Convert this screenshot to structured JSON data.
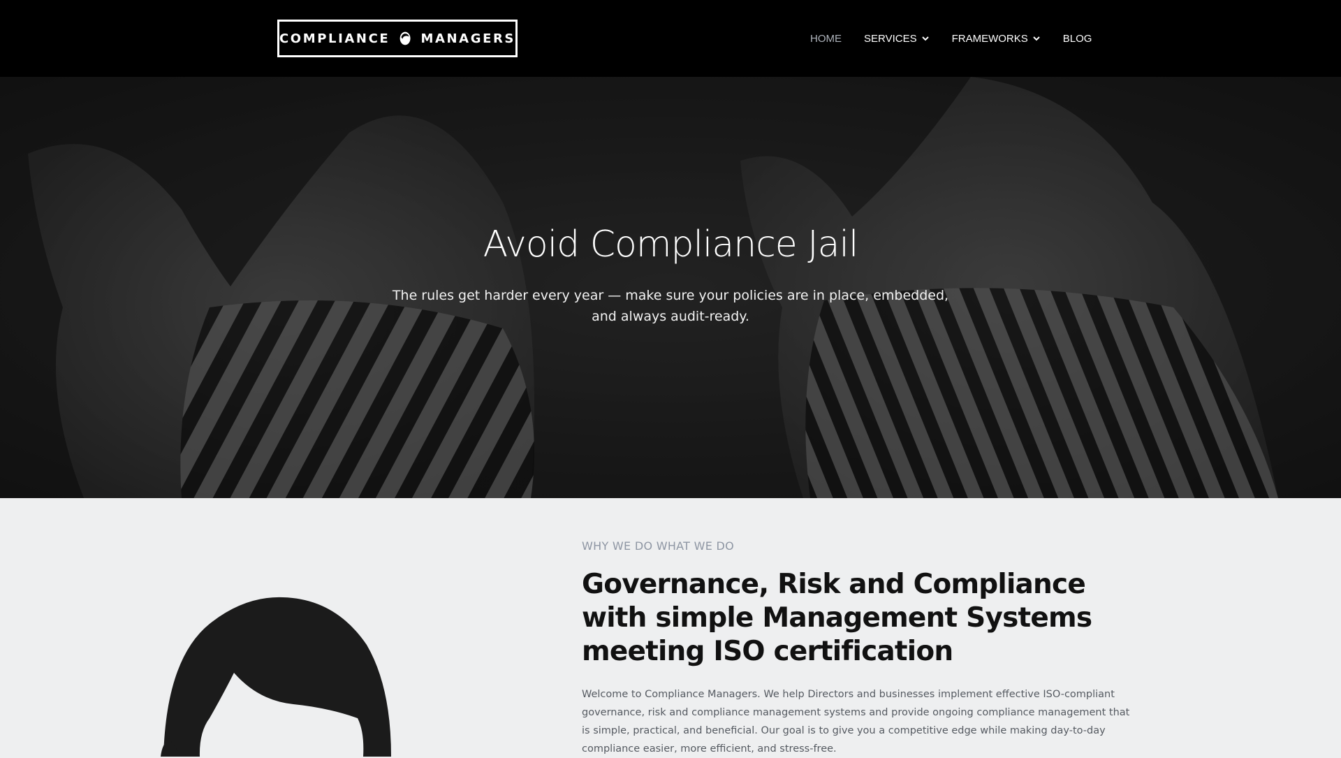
{
  "header": {
    "logo": {
      "text_left": "COMPLIANCE",
      "text_right": "MANAGERS",
      "icon": "head-silhouette-icon"
    },
    "nav": [
      {
        "label": "HOME",
        "active": true,
        "has_dropdown": false
      },
      {
        "label": "SERVICES",
        "active": false,
        "has_dropdown": true
      },
      {
        "label": "FRAMEWORKS",
        "active": false,
        "has_dropdown": true
      },
      {
        "label": "BLOG",
        "active": false,
        "has_dropdown": false
      }
    ]
  },
  "hero": {
    "title": "Avoid Compliance Jail",
    "subtitle": "The rules get harder every year — make sure your policies are in place, embedded, and always audit-ready."
  },
  "about": {
    "eyebrow": "WHY WE DO WHAT WE DO",
    "heading": "Governance, Risk and Compliance with simple Management Systems meeting ISO certification",
    "body": "Welcome to Compliance Managers. We help Directors and businesses implement effective ISO-compliant governance, risk and compliance management systems and provide ongoing compliance management that is simple, practical, and beneficial. Our goal is to give you a competitive edge while making day-to-day compliance easier, more efficient, and stress-free."
  },
  "colors": {
    "header_bg": "#000000",
    "nav_active": "#aeb3bb",
    "page_bg": "#eeeff0",
    "eyebrow": "#8e96a3",
    "heading": "#111111",
    "body_text": "#555a61"
  }
}
